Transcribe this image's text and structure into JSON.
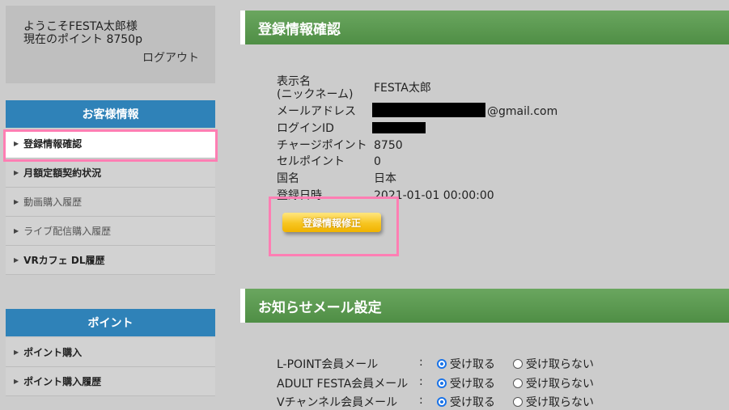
{
  "welcome": {
    "greeting": "ようこそFESTA太郎様",
    "points": "現在のポイント 8750p",
    "logout": "ログアウト"
  },
  "customer_menu": {
    "title": "お客様情報",
    "items": [
      {
        "label": "登録情報確認"
      },
      {
        "label": "月額定額契約状況"
      },
      {
        "label": "動画購入履歴"
      },
      {
        "label": "ライブ配信購入履歴"
      },
      {
        "label": "VRカフェ DL履歴"
      }
    ]
  },
  "point_menu": {
    "title": "ポイント",
    "items": [
      {
        "label": "ポイント購入"
      },
      {
        "label": "ポイント購入履歴"
      }
    ]
  },
  "registration": {
    "title": "登録情報確認",
    "display_name_label_1": "表示名",
    "display_name_label_2": "(ニックネーム)",
    "display_name": "FESTA太郎",
    "email_label": "メールアドレス",
    "email_suffix": "@gmail.com",
    "login_id_label": "ログインID",
    "charge_points_label": "チャージポイント",
    "charge_points": "8750",
    "sell_points_label": "セルポイント",
    "sell_points": "0",
    "country_label": "国名",
    "country": "日本",
    "registered_label": "登録日時",
    "registered": "2021-01-01 00:00:00",
    "edit_button": "登録情報修正"
  },
  "mail_settings": {
    "title": "お知らせメール設定",
    "colon": ":",
    "receive": "受け取る",
    "not_receive": "受け取らない",
    "rows": [
      {
        "label": "L-POINT会員メール"
      },
      {
        "label": "ADULT FESTA会員メール"
      },
      {
        "label": "Vチャンネル会員メール"
      }
    ]
  }
}
